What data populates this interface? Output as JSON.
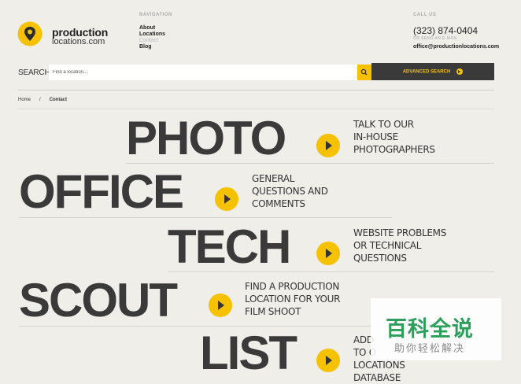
{
  "logo": {
    "word1": "production",
    "word2": "locations.com"
  },
  "nav": {
    "label": "NAVIGATION",
    "items": [
      {
        "label": "About",
        "dim": false
      },
      {
        "label": "Locations",
        "dim": false
      },
      {
        "label": "Contact",
        "dim": true
      },
      {
        "label": "Blog",
        "dim": false
      }
    ]
  },
  "contact_info": {
    "call_label": "CALL US",
    "phone": "(323) 874-0404",
    "email_label": "OR SEND AN E-MAIL",
    "email": "office@productionlocations.com"
  },
  "search": {
    "label": "SEARCH:",
    "placeholder": "Find a location...",
    "advanced_label": "ADVANCED SEARCH"
  },
  "breadcrumb": {
    "home": "Home",
    "separator": "/",
    "current": "Contact"
  },
  "rows": [
    {
      "word": "PHOTO",
      "lines": [
        "TALK TO OUR",
        "IN-HOUSE",
        "PHOTOGRAPHERS"
      ]
    },
    {
      "word": "OFFICE",
      "lines": [
        "GENERAL",
        "QUESTIONS AND",
        "COMMENTS"
      ]
    },
    {
      "word": "TECH",
      "lines": [
        "WEBSITE PROBLEMS",
        "OR TECHNICAL",
        "QUESTIONS"
      ]
    },
    {
      "word": "SCOUT",
      "lines": [
        "FIND A PRODUCTION",
        "LOCATION FOR YOUR",
        "FILM SHOOT"
      ]
    },
    {
      "word": "LIST",
      "lines": [
        "ADD",
        "TO O",
        "LOCATIONS",
        "DATABASE"
      ]
    }
  ],
  "watermark": {
    "title": "百科全说",
    "subtitle": "助你轻松解决"
  },
  "colors": {
    "accent": "#f6c200",
    "dark": "#3a3a3a",
    "background": "#efeee9",
    "watermark": "#2ca05a"
  }
}
